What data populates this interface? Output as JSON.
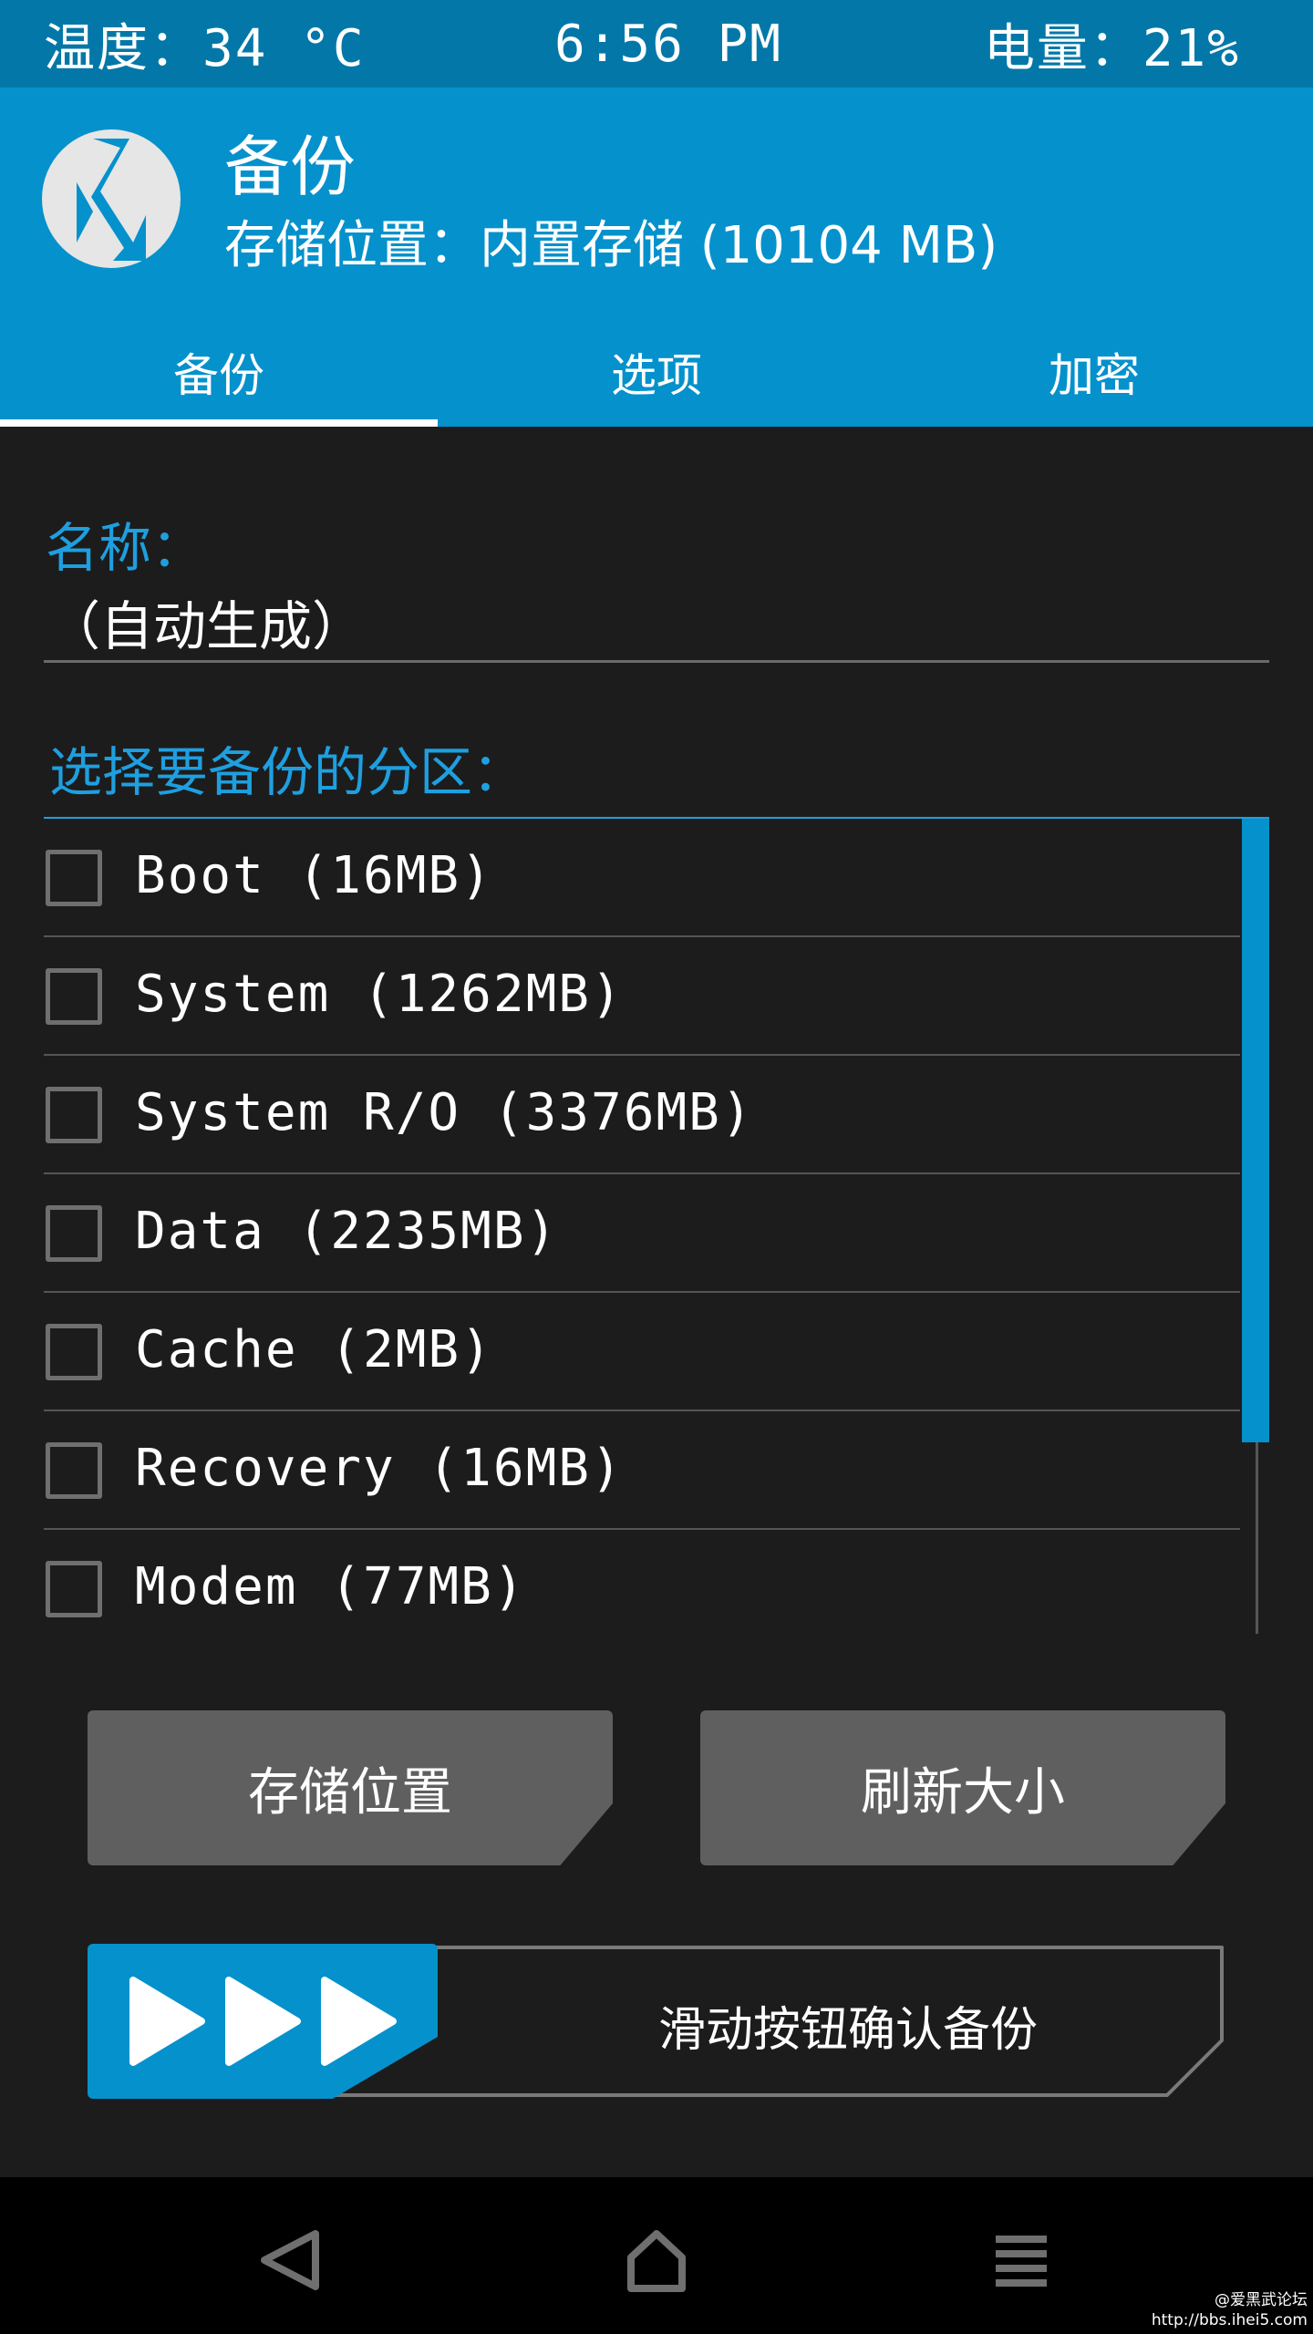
{
  "status_bar": {
    "temperature": "温度：34 °C",
    "time": "6:56 PM",
    "battery": "电量：21%"
  },
  "header": {
    "logo_icon": "twrp-logo-icon",
    "title": "备份",
    "storage_info": "存储位置：内置存储 (10104 MB)"
  },
  "tabs": [
    {
      "label": "备份",
      "active": true
    },
    {
      "label": "选项",
      "active": false
    },
    {
      "label": "加密",
      "active": false
    }
  ],
  "name_section": {
    "label": "名称：",
    "value": "（自动生成）"
  },
  "partition_section": {
    "label": "选择要备份的分区：",
    "items": [
      {
        "label": "Boot (16MB)",
        "checked": false
      },
      {
        "label": "System (1262MB)",
        "checked": false
      },
      {
        "label": "System R/O (3376MB)",
        "checked": false
      },
      {
        "label": "Data (2235MB)",
        "checked": false
      },
      {
        "label": "Cache (2MB)",
        "checked": false
      },
      {
        "label": "Recovery (16MB)",
        "checked": false
      },
      {
        "label": "Modem (77MB)",
        "checked": false
      }
    ]
  },
  "buttons": {
    "storage_location": "存储位置",
    "refresh_size": "刷新大小"
  },
  "swipe": {
    "label": "滑动按钮确认备份",
    "icon": "triple-arrow-icon"
  },
  "nav_bar": {
    "back_icon": "back-triangle-icon",
    "home_icon": "home-icon",
    "menu_icon": "menu-icon"
  },
  "watermark": {
    "line1": "@爱黑武论坛",
    "line2": "http://bbs.ihei5.com"
  },
  "colors": {
    "header_blue": "#0591cc",
    "status_blue": "#0378a8",
    "accent_text": "#1e9fe0",
    "background": "#1c1c1c",
    "button_gray": "#5f5f5f"
  }
}
